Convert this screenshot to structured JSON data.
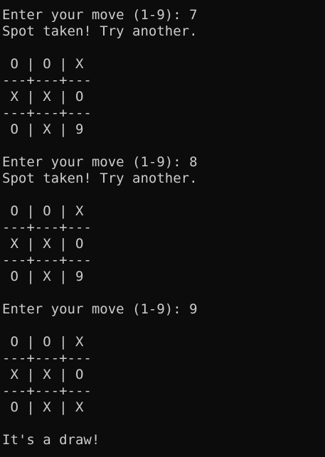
{
  "terminal": {
    "lines": [
      "Enter your move (1-9): 7",
      "Spot taken! Try another.",
      "",
      " O | O | X",
      "---+---+---",
      " X | X | O",
      "---+---+---",
      " O | X | 9",
      "",
      "Enter your move (1-9): 8",
      "Spot taken! Try another.",
      "",
      " O | O | X",
      "---+---+---",
      " X | X | O",
      "---+---+---",
      " O | X | 9",
      "",
      "Enter your move (1-9): 9",
      "",
      " O | O | X",
      "---+---+---",
      " X | X | O",
      "---+---+---",
      " O | X | X",
      "",
      "It's a draw!"
    ]
  },
  "colors": {
    "background": "#0c0c0c",
    "foreground": "#cccccc"
  }
}
